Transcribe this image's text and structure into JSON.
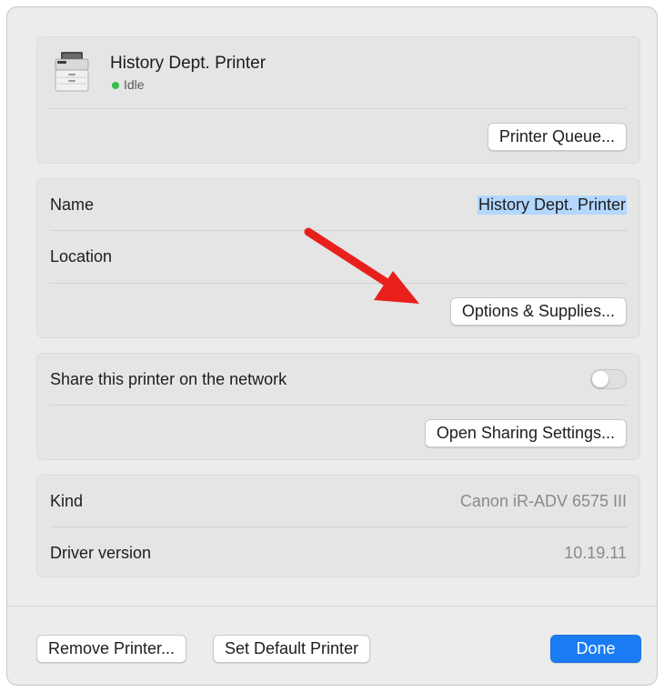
{
  "printer": {
    "name": "History Dept. Printer",
    "status": "Idle",
    "status_color": "#30c24a",
    "queue_button": "Printer Queue..."
  },
  "details": {
    "name_label": "Name",
    "name_value": "History Dept. Printer",
    "location_label": "Location",
    "location_value": "",
    "options_button": "Options & Supplies..."
  },
  "sharing": {
    "share_label": "Share this printer on the network",
    "share_enabled": false,
    "open_settings_button": "Open Sharing Settings..."
  },
  "info": {
    "kind_label": "Kind",
    "kind_value": "Canon iR-ADV 6575 III",
    "driver_label": "Driver version",
    "driver_value": "10.19.11"
  },
  "footer": {
    "remove_button": "Remove Printer...",
    "default_button": "Set Default Printer",
    "done_button": "Done"
  },
  "icons": {
    "printer": "printer-icon",
    "annotation": "red-arrow-annotation"
  },
  "colors": {
    "accent": "#1a7cf5",
    "annotation": "#e8201c",
    "selection": "#b3d7ff"
  }
}
